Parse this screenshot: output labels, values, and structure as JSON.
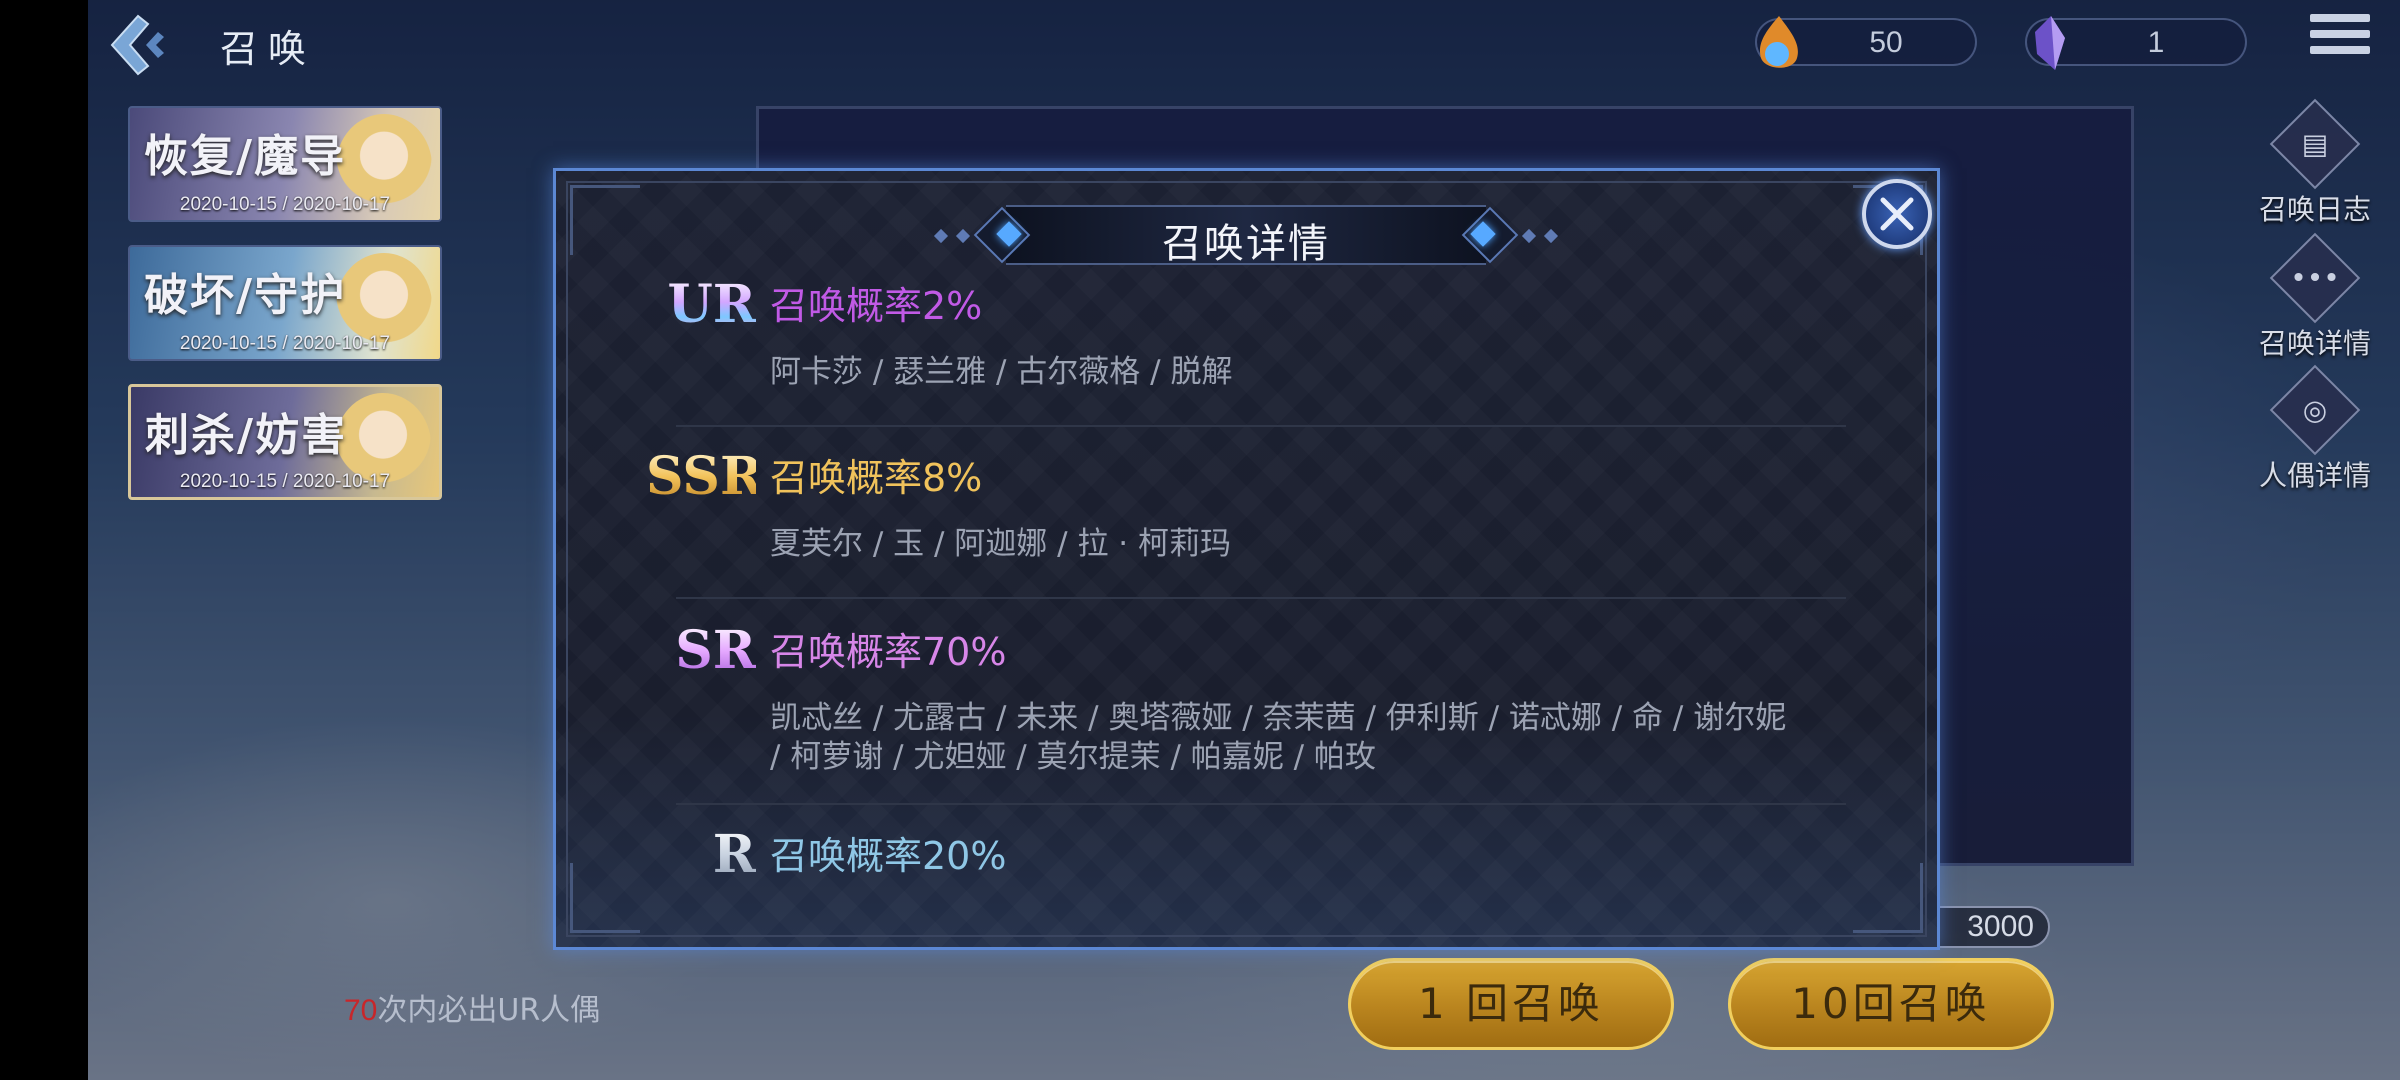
{
  "header": {
    "title": "召唤"
  },
  "currencies": [
    {
      "name": "crystal",
      "value": "50"
    },
    {
      "name": "gem",
      "value": "1"
    }
  ],
  "banners": [
    {
      "name_a": "恢复",
      "name_b": "魔导",
      "date": "2020-10-15 / 2020-10-17"
    },
    {
      "name_a": "破坏",
      "name_b": "守护",
      "date": "2020-10-15 / 2020-10-17"
    },
    {
      "name_a": "刺杀",
      "name_b": "妨害",
      "date": "2020-10-15 / 2020-10-17"
    }
  ],
  "side_menu": [
    {
      "label": "召唤日志",
      "icon": "book-icon"
    },
    {
      "label": "召唤详情",
      "icon": "ellipsis-icon"
    },
    {
      "label": "人偶详情",
      "icon": "doll-detail-icon"
    }
  ],
  "bottom": {
    "cost_value": "3000",
    "summon_one": "1 回召唤",
    "summon_ten": "10回召唤",
    "pity_count": "70",
    "pity_text": "次内必出UR人偶"
  },
  "modal": {
    "title": "召唤详情",
    "tiers": [
      {
        "rank": "UR",
        "rate": "召唤概率2%",
        "names": "阿卡莎 / 瑟兰雅 / 古尔薇格 / 脱解"
      },
      {
        "rank": "SSR",
        "rate": "召唤概率8%",
        "names": "夏芙尔 / 玉 / 阿迦娜 / 拉 · 柯莉玛"
      },
      {
        "rank": "SR",
        "rate": "召唤概率70%",
        "names": "凯忒丝 / 尤露古 / 未来 / 奥塔薇娅 / 奈茉茜 / 伊利斯 / 诺忒娜 / 命 / 谢尔妮 / 柯萝谢 / 尤妲娅 / 莫尔提茉 / 帕嘉妮 / 帕玫"
      },
      {
        "rank": "R",
        "rate": "召唤概率20%",
        "names": ""
      }
    ]
  },
  "colors": {
    "ur": "#c15ae6",
    "ssr": "#f0c25b",
    "sr": "#d786e8",
    "r": "#8fc7e6",
    "modal_border": "#5c88d4",
    "summon_button": "#c8961f",
    "pity_number": "#c8262a"
  }
}
